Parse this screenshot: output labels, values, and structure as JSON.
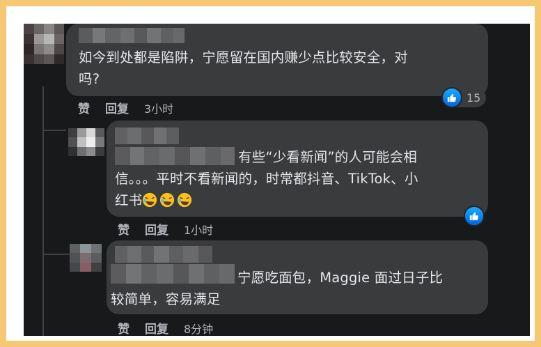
{
  "comments": [
    {
      "text_line1": "如今到处都是陷阱，宁愿留在国内赚少点比较安全，对",
      "text_line2": "吗?",
      "like_label": "赞",
      "reply_label": "回复",
      "time": "3小时",
      "reaction_count": "15"
    },
    {
      "text_line1": "有些“少看新闻”的人可能会相",
      "text_line2": "信。。。平时不看新闻的，时常都抖音、TikTok、小",
      "text_line3": "红书",
      "emoji_name": "rolling-on-floor-laughing",
      "like_label": "赞",
      "reply_label": "回复",
      "time": "1小时"
    },
    {
      "text_line1": "宁愿吃面包，Maggie 面过日子比",
      "text_line2": "较简单，容易满足",
      "like_label": "赞",
      "reply_label": "回复",
      "time": "8分钟"
    }
  ],
  "colors": {
    "background": "#18191a",
    "bubble": "#3a3b3c",
    "text": "#e4e6eb",
    "secondary_text": "#b0b3b8",
    "like_blue": "#0866ff",
    "outer_border": "#f6c874"
  },
  "icons": [
    "thumbs-up-icon",
    "laughing-emoji-icon"
  ]
}
